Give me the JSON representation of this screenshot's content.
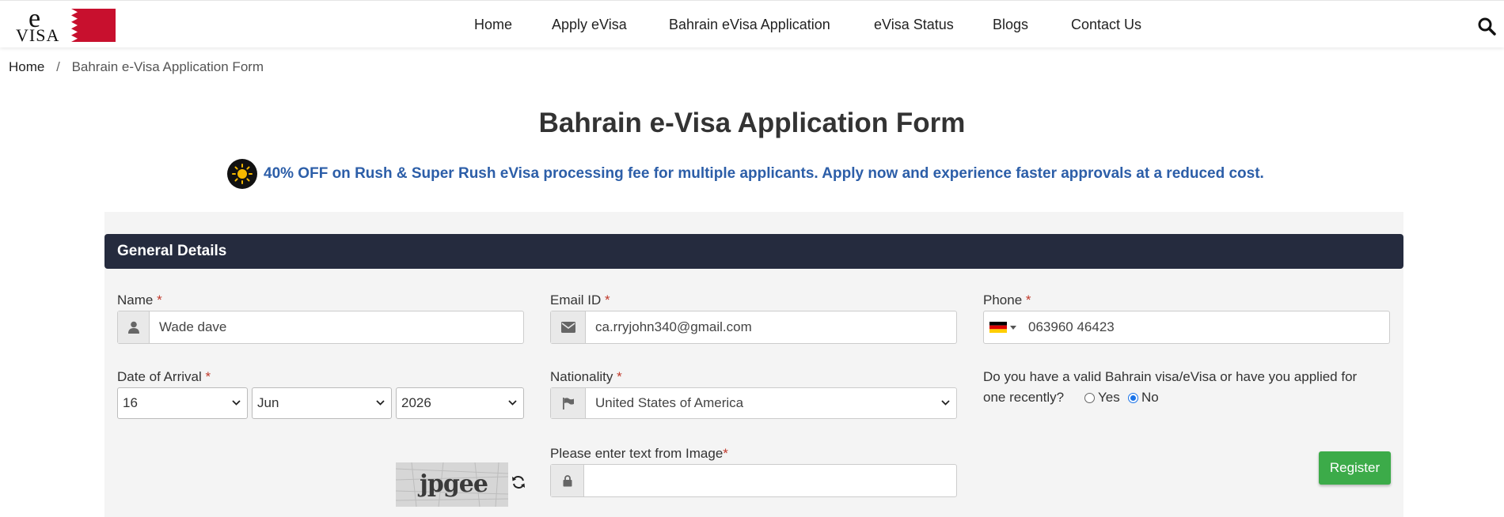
{
  "logo": {
    "letter": "e",
    "word": "VISA"
  },
  "nav": {
    "items": [
      "Home",
      "Apply eVisa",
      "Bahrain eVisa Application",
      "eVisa Status",
      "Blogs",
      "Contact Us"
    ]
  },
  "breadcrumb": {
    "home": "Home",
    "separator": "/",
    "current": "Bahrain e-Visa Application Form"
  },
  "page": {
    "title": "Bahrain e-Visa Application Form",
    "promo": "40% OFF on Rush & Super Rush eVisa processing fee for multiple applicants. Apply now and experience faster approvals at a reduced cost."
  },
  "form": {
    "section_title": "General Details",
    "name": {
      "label": "Name",
      "value": "Wade dave"
    },
    "email": {
      "label": "Email ID",
      "value": "ca.rryjohn340@gmail.com"
    },
    "phone": {
      "label": "Phone",
      "value": "063960 46423",
      "country_flag": "germany-flag"
    },
    "arrival": {
      "label": "Date of Arrival",
      "day": "16",
      "month": "Jun",
      "year": "2026"
    },
    "nationality": {
      "label": "Nationality",
      "value": "United States of America"
    },
    "prior_visa": {
      "question_line1": "Do you have a valid Bahrain visa/eVisa or have you applied for",
      "question_line2": "one recently?",
      "yes": "Yes",
      "no": "No",
      "selected": "No"
    },
    "captcha": {
      "label": "Please enter text from Image",
      "image_text": "jpgee",
      "value": ""
    },
    "required_mark": "*",
    "register": "Register"
  },
  "colors": {
    "promo_text": "#2c5ea8",
    "header_bg": "#252b3e",
    "register_bg": "#3cab49",
    "required": "#c0392b"
  }
}
